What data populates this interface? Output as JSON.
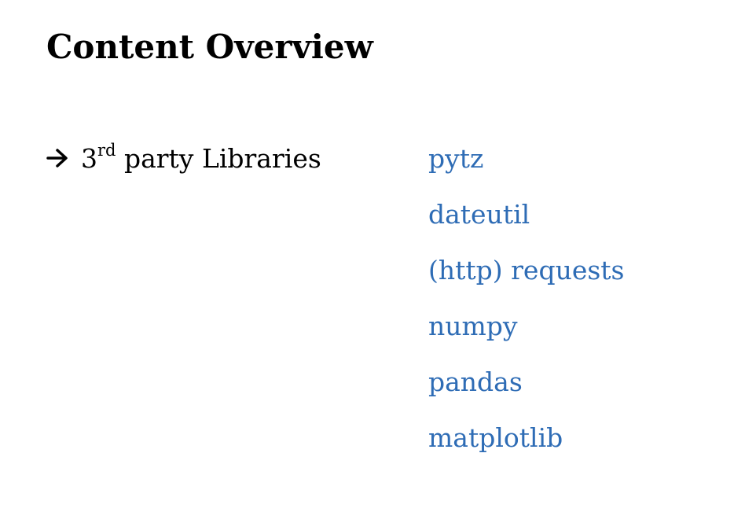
{
  "slide": {
    "title": "Content Overview",
    "topic": {
      "arrow_icon": "arrow-right-icon",
      "ordinal_number": "3",
      "ordinal_suffix": "rd",
      "text": " party Libraries"
    },
    "libraries": [
      "pytz",
      "dateutil",
      "(http) requests",
      "numpy",
      "pandas",
      "matplotlib"
    ]
  },
  "colors": {
    "text": "#000000",
    "accent_link": "#2e6cb5",
    "background": "#ffffff"
  }
}
